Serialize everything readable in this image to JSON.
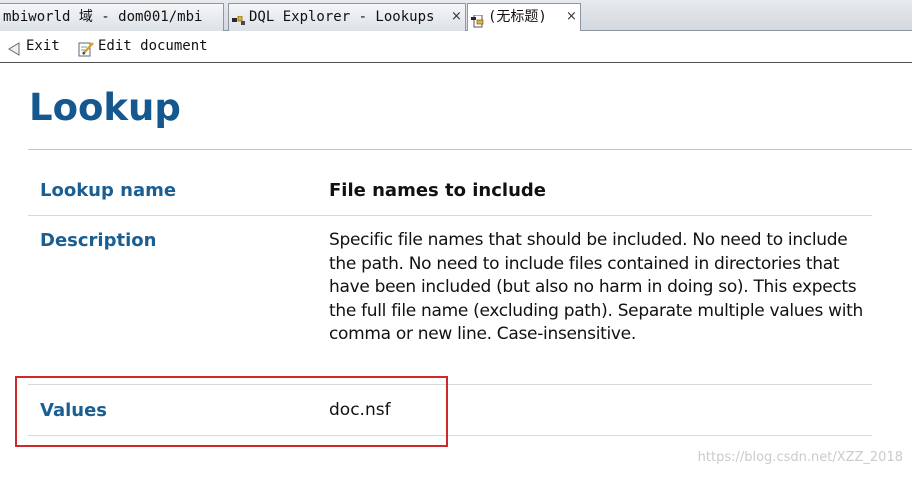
{
  "tabs": [
    {
      "label": "mbiworld 域 - dom001/mbi",
      "active": false
    },
    {
      "label": "DQL Explorer - Lookups",
      "active": false,
      "icon": "dql-icon",
      "close": "×"
    },
    {
      "label": "(无标题)",
      "active": true,
      "icon": "document-icon",
      "close": "×"
    }
  ],
  "actions": {
    "exit_label": "Exit",
    "edit_label": "Edit document"
  },
  "document": {
    "title": "Lookup",
    "fields": [
      {
        "label": "Lookup name",
        "value": "File names to include"
      },
      {
        "label": "Description",
        "value": "Specific file names that should be included. No need to include the path. No need to include files contained in directories that have been included (but also no harm in doing so). This expects the full file name (excluding path). Separate multiple values with comma or new line. Case-insensitive."
      },
      {
        "label": "Values",
        "value": "doc.nsf"
      }
    ]
  },
  "watermark": "https://blog.csdn.net/XZZ_2018",
  "colors": {
    "title": "#15578f",
    "label": "#1b5e92",
    "highlight": "#cf2a2a"
  }
}
